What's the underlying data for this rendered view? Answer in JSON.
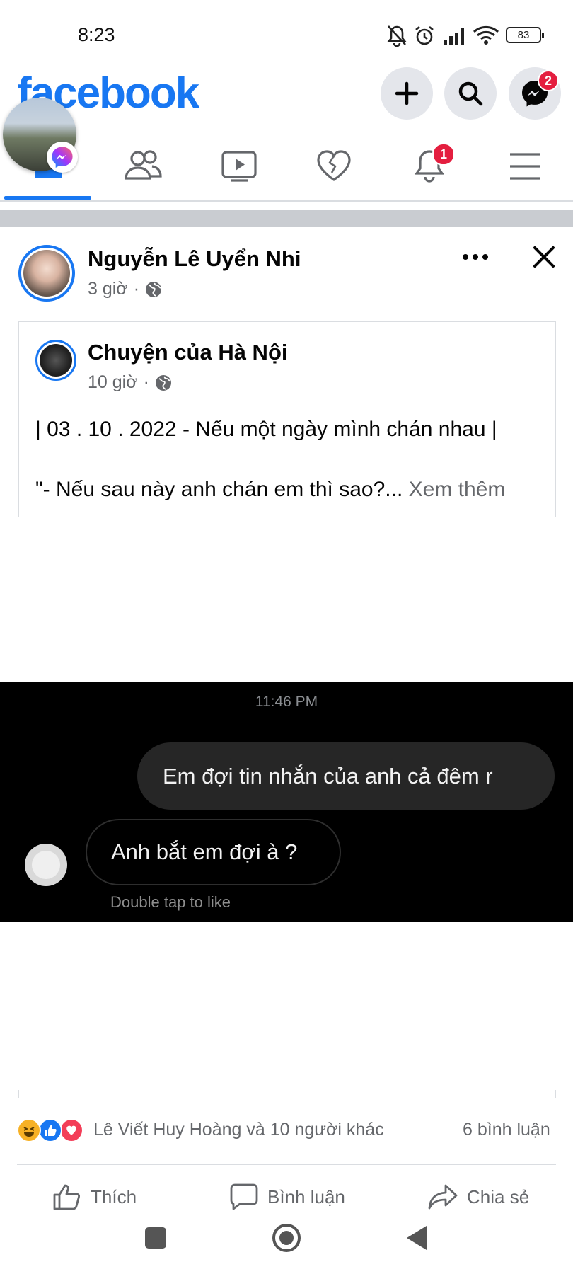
{
  "status_bar": {
    "time": "8:23",
    "battery": "83"
  },
  "header": {
    "logo": "facebook",
    "messenger_badge": "2"
  },
  "nav": {
    "notifications_badge": "1"
  },
  "post": {
    "author": "Nguyễn Lê Uyển Nhi",
    "time": "3 giờ",
    "shared": {
      "page_name": "Chuyện của Hà Nội",
      "time": "10 giờ",
      "line1": "| 03 . 10 . 2022 - Nếu một ngày mình chán nhau |",
      "line2": "\"- Nếu sau này anh chán em thì sao?...",
      "see_more": "Xem thêm"
    },
    "screenshot": {
      "time": "11:46 PM",
      "sent_message": "Em đợi tin nhắn của anh cả đêm r",
      "received_message": "Anh bắt em đợi à ?",
      "hint": "Double tap to like"
    },
    "reactions_text": "Lê Viết Huy Hoàng và 10 người khác",
    "comments": "6 bình luận",
    "actions": {
      "like": "Thích",
      "comment": "Bình luận",
      "share": "Chia sẻ"
    }
  },
  "colors": {
    "brand": "#1877f2",
    "badge": "#e41e3f",
    "secondary_text": "#65676b"
  }
}
